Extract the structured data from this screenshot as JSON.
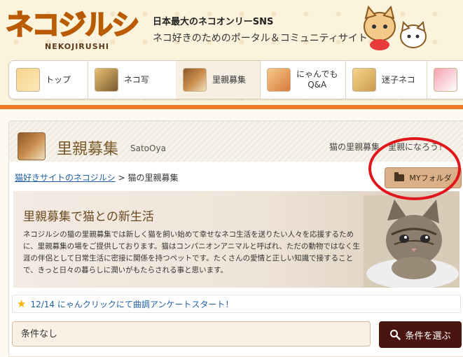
{
  "header": {
    "logo_main": "ネコジルシ",
    "logo_sub": "NEKOJIRUSHI",
    "tagline_title": "日本最大のネコオンリーSNS",
    "tagline_sub": "ネコ好きのためのポータル＆コミュニティサイト"
  },
  "nav": {
    "items": [
      {
        "label": "トップ",
        "active": false
      },
      {
        "label": "ネコ写",
        "active": false
      },
      {
        "label": "里親募集",
        "active": true
      },
      {
        "label": "にゃんでも\nQ&A",
        "active": false
      },
      {
        "label": "迷子ネコ",
        "active": false
      }
    ]
  },
  "section": {
    "title": "里親募集",
    "romaji": "SatoOya",
    "right_text": "猫の里親募集・里親になろう！"
  },
  "breadcrumb": {
    "home": "猫好きサイトのネコジルシ",
    "separator": ">",
    "current": "猫の里親募集"
  },
  "folder_button": {
    "label": "MYフォルダ"
  },
  "hero": {
    "title": "里親募集で猫との新生活",
    "body": "ネコジルシの猫の里親募集では新しく猫を飼い始めて幸せなネコ生活を送りたい人々を応援するために、里親募集の場をご提供しております。猫はコンパニオンアニマルと呼ばれ、ただの動物ではなく生涯の伴侶として日常生活に密接に関係を持つペットです。たくさんの愛情と正しい知識で接することで、きっと日々の暮らしに潤いがもたらされる事と思います。"
  },
  "notice": {
    "text": "12/14 にゃんクリックにて曲調アンケートスタート！"
  },
  "search": {
    "value": "条件なし",
    "button_label": "条件を選ぶ"
  },
  "colors": {
    "accent_orange": "#ec7a22",
    "search_button": "#4a1410",
    "folder_button": "#d9b088",
    "highlight_circle": "#e0161b"
  }
}
